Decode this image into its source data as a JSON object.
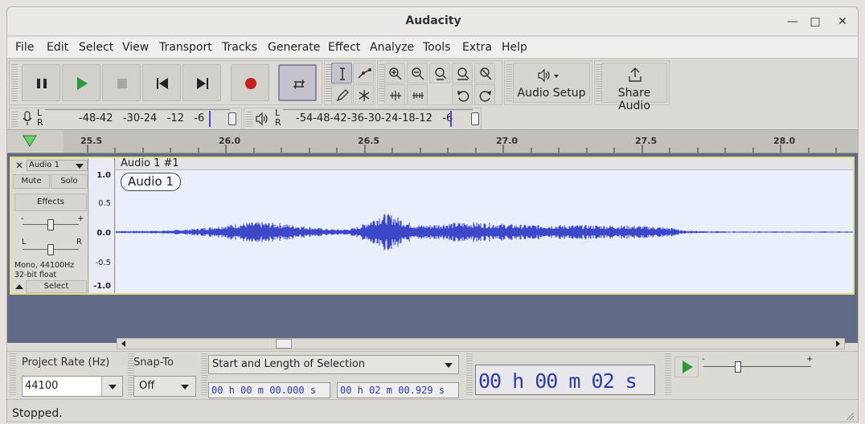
{
  "window": {
    "title": "Audacity"
  },
  "menu": [
    "File",
    "Edit",
    "Select",
    "View",
    "Transport",
    "Tracks",
    "Generate",
    "Effect",
    "Analyze",
    "Tools",
    "Extra",
    "Help"
  ],
  "toolbar": {
    "audio_setup_label": "Audio Setup",
    "share_audio_label": "Share Audio"
  },
  "meters": {
    "record_lr": [
      "L",
      "R"
    ],
    "record_ticks": "-48-42   -30-24   -12   -6",
    "play_lr": [
      "L",
      "R"
    ],
    "play_ticks": "-54-48-42-36-30-24-18-12   -6"
  },
  "ruler": {
    "labels": [
      "25.5",
      "26.0",
      "26.5",
      "27.0",
      "27.5",
      "28.0"
    ]
  },
  "track": {
    "name": "Audio 1",
    "mute_label": "Mute",
    "solo_label": "Solo",
    "effects_label": "Effects",
    "gain_minus": "-",
    "gain_plus": "+",
    "pan_left": "L",
    "pan_right": "R",
    "info_line1": "Mono, 44100Hz",
    "info_line2": "32-bit float",
    "select_label": "Select",
    "clip_title": "Audio 1 #1",
    "clip_label": "Audio 1",
    "scale": [
      "1.0",
      "0.5",
      "0.0",
      "-0.5",
      "-1.0"
    ]
  },
  "selection": {
    "project_rate_label": "Project Rate (Hz)",
    "project_rate_value": "44100",
    "snap_label": "Snap-To",
    "snap_value": "Off",
    "selection_mode": "Start and Length of Selection",
    "start_time": "00 h 00 m 00.000 s",
    "length_time": "00 h 02 m 00.929 s",
    "big_time": "00 h 00 m 02 s",
    "speed_minus": "-",
    "speed_plus": "+"
  },
  "status": {
    "text": "Stopped."
  },
  "colors": {
    "record": "#c8201e",
    "play": "#2a9a3a",
    "wave": "#3c48c8",
    "selection_border": "#e6e07a"
  }
}
